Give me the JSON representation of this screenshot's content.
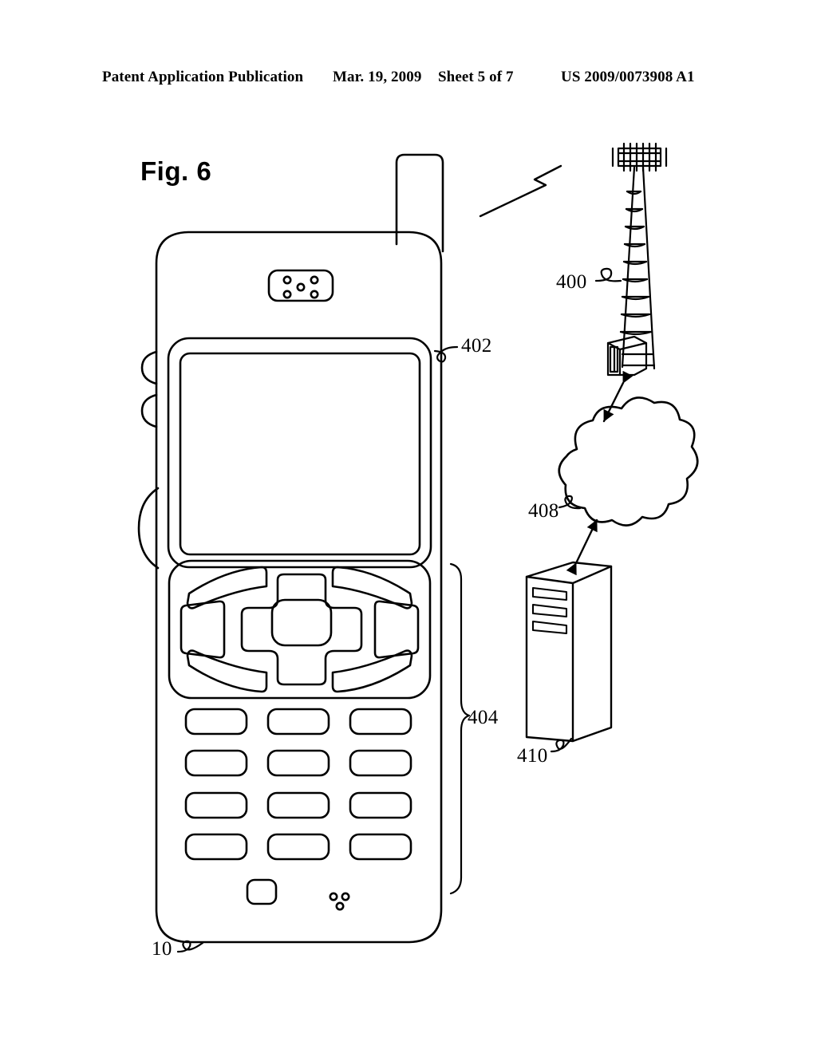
{
  "document": {
    "type": "patent-application-publication-figure",
    "header": {
      "publication_label": "Patent Application Publication",
      "date": "Mar. 19, 2009",
      "sheet": "Sheet 5 of 7",
      "publication_number": "US 2009/0073908 A1"
    },
    "figure": {
      "label": "Fig. 6",
      "caption": ""
    }
  },
  "reference_numerals": {
    "tower": "400",
    "display": "402",
    "keypad": "404",
    "network_cloud": "408",
    "server": "410",
    "handset": "10"
  },
  "drawing_elements": {
    "handset": {
      "name": "mobile-handset",
      "numeral": "10",
      "antenna": "antenna-stub",
      "earpiece": "earpiece-speaker-grille",
      "earpiece_hole_count": 5,
      "display": {
        "name": "display-screen",
        "numeral": "402",
        "content": ""
      },
      "navigation": {
        "name": "navigation-cluster",
        "center_key": "center-select-key",
        "directional_pad": "four-way-directional-pad",
        "soft_keys": [
          "soft-key-top-left",
          "soft-key-top-right",
          "soft-key-bottom-left",
          "soft-key-bottom-right"
        ],
        "side_keys": [
          "side-key-left",
          "side-key-right"
        ]
      },
      "keypad": {
        "name": "numeric-keypad",
        "numeral": "404",
        "rows": 4,
        "columns": 3,
        "key_labels": [
          "",
          "",
          "",
          "",
          "",
          "",
          "",
          "",
          "",
          "",
          "",
          ""
        ]
      },
      "bottom_button": "bottom-function-button",
      "microphone": "microphone-holes",
      "microphone_hole_count": 3,
      "edge_buttons": [
        "edge-button-upper",
        "edge-button-middle",
        "edge-button-lower"
      ]
    },
    "tower": {
      "name": "cellular-base-station-tower",
      "numeral": "400",
      "parts": [
        "antenna-array",
        "lattice-mast",
        "equipment-shelter"
      ]
    },
    "cloud": {
      "name": "network-cloud",
      "numeral": "408",
      "label": ""
    },
    "server": {
      "name": "server-computer",
      "numeral": "410",
      "drive_bay_count": 3
    },
    "links": [
      {
        "name": "wireless-rf-link",
        "from": "handset",
        "to": "tower",
        "style": "lightning-bolt",
        "arrowheads": "none"
      },
      {
        "name": "tower-cloud-link",
        "from": "tower",
        "to": "cloud",
        "style": "line",
        "arrowheads": "both"
      },
      {
        "name": "cloud-server-link",
        "from": "cloud",
        "to": "server",
        "style": "line",
        "arrowheads": "both"
      }
    ]
  },
  "colors": {
    "ink": "#000000",
    "paper": "#ffffff"
  }
}
